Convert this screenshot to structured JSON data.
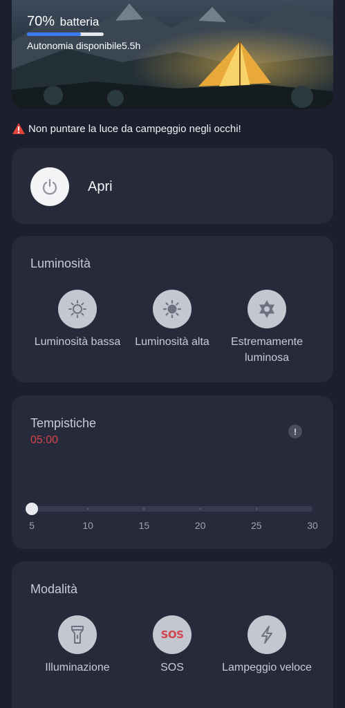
{
  "battery": {
    "percent_value": "70",
    "percent_unit": "%",
    "label": "batteria",
    "level": 0.7,
    "autonomy_label": "Autonomia disponibile",
    "autonomy_value": "5.5h"
  },
  "warning": {
    "text": "Non puntare la luce da campeggio negli occhi!"
  },
  "power": {
    "label": "Apri"
  },
  "brightness": {
    "title": "Luminosità",
    "options": [
      {
        "label": "Luminosità bassa",
        "icon": "sun-low-icon"
      },
      {
        "label": "Luminosità alta",
        "icon": "sun-high-icon"
      },
      {
        "label": "Estremamente luminosa",
        "icon": "sun-gear-icon"
      }
    ]
  },
  "timing": {
    "title": "Tempistiche",
    "value": "05:00",
    "slider_min": 5,
    "slider_max": 30,
    "slider_value": 5,
    "ticks": [
      "5",
      "10",
      "15",
      "20",
      "25",
      "30"
    ]
  },
  "modes": {
    "title": "Modalità",
    "options": [
      {
        "label": "Illuminazione",
        "icon": "flashlight-icon"
      },
      {
        "label": "SOS",
        "icon_text": "SOS"
      },
      {
        "label": "Lampeggio veloce",
        "icon": "lightning-icon"
      }
    ]
  },
  "colors": {
    "accent_red": "#d2454f",
    "battery_fill": "#3b7bf2",
    "card_bg": "#272a3a",
    "page_bg": "#1d1f2e"
  }
}
